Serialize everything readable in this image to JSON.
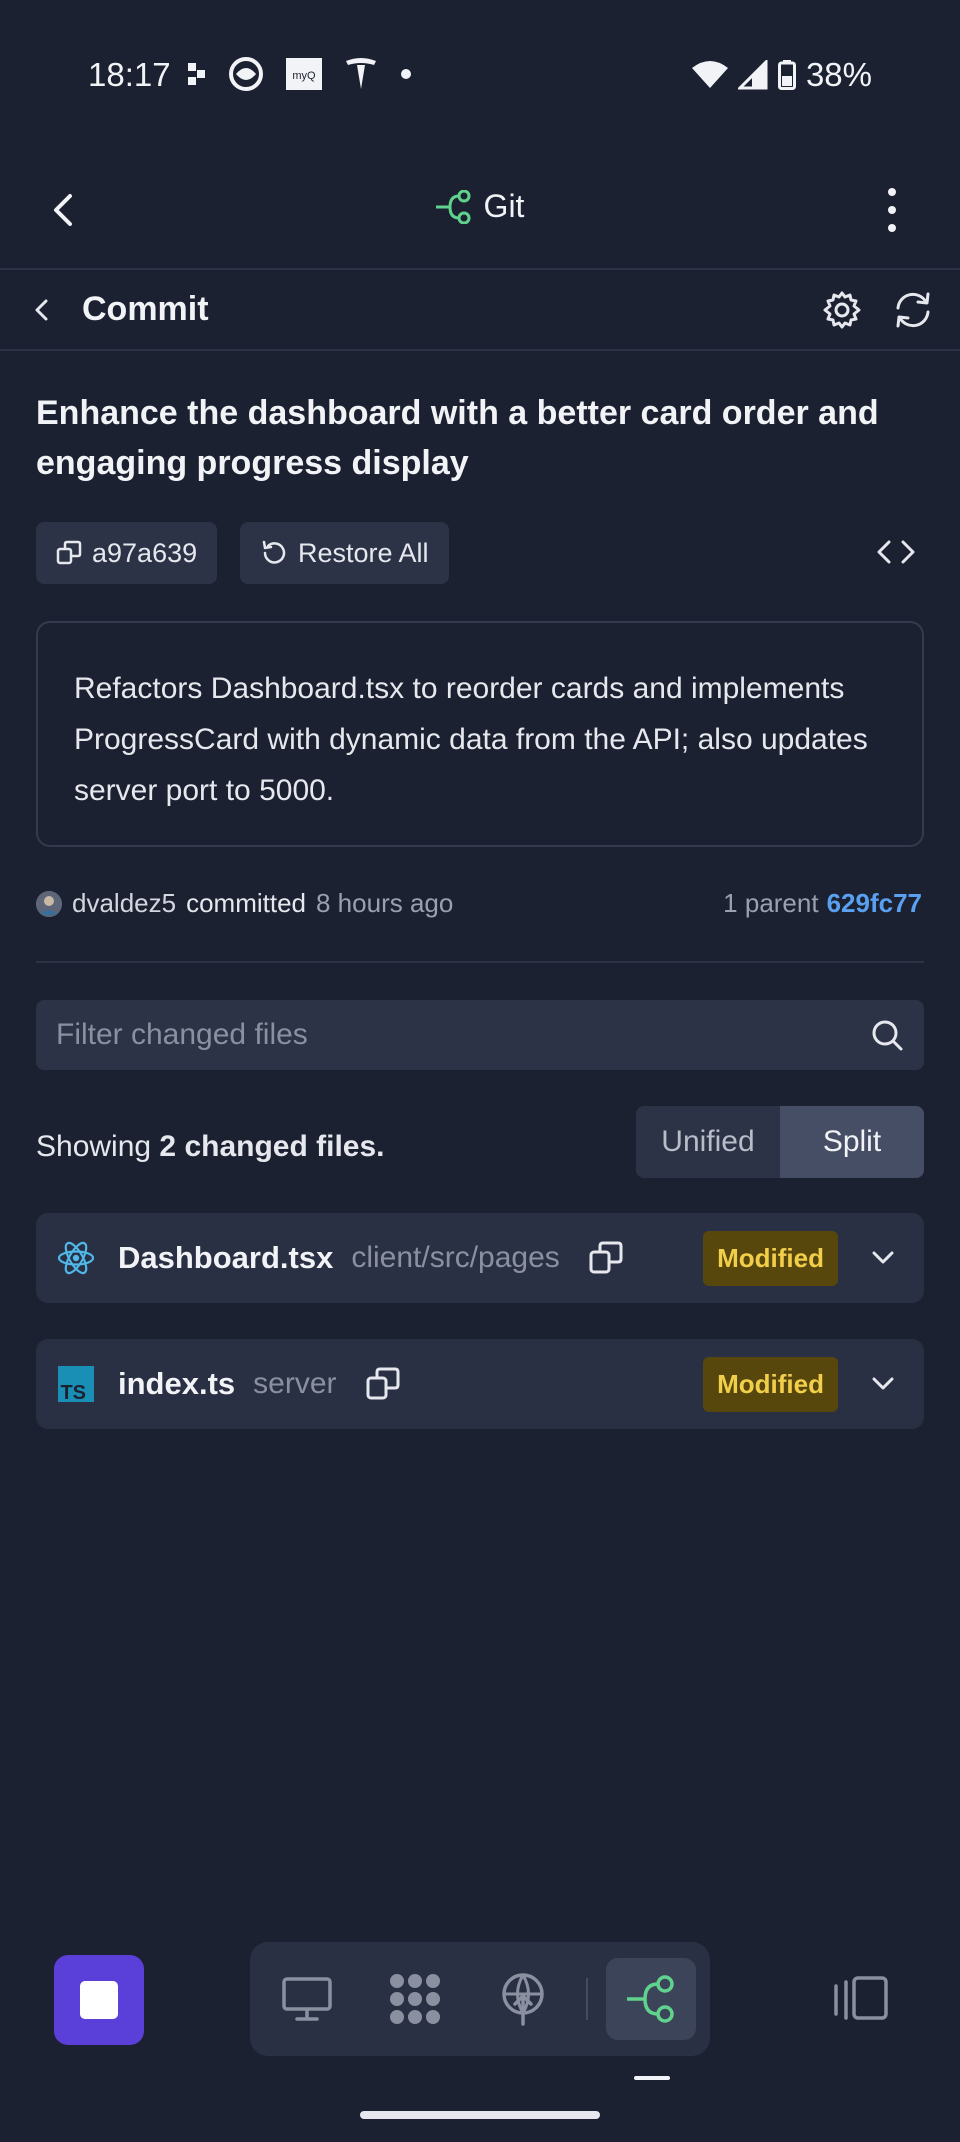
{
  "status_bar": {
    "time": "18:17",
    "battery": "38%",
    "left_icons": [
      "notification-dots-icon",
      "pinwheel-app-icon",
      "myq-app-icon",
      "tesla-app-icon",
      "dot-icon"
    ],
    "right_icons": [
      "wifi-icon",
      "cell-signal-icon",
      "battery-icon"
    ]
  },
  "app_bar": {
    "title": "Git"
  },
  "commit_header": {
    "title": "Commit"
  },
  "commit": {
    "heading": "Enhance the dashboard with a better card order and engaging progress display",
    "hash_label": "a97a639",
    "restore_label": "Restore All",
    "message": "Refactors Dashboard.tsx to reorder cards and implements ProgressCard with dynamic data from the API; also updates server port to 5000.",
    "author": "dvaldez5",
    "committed_label": "committed",
    "time_ago": "8 hours ago",
    "parent_label": "1 parent",
    "parent_hash": "629fc77"
  },
  "filter": {
    "placeholder": "Filter changed files"
  },
  "summary": {
    "prefix": "Showing",
    "count_text": "2 changed files."
  },
  "view_toggle": {
    "unified": "Unified",
    "split": "Split",
    "selected": "Split"
  },
  "files": [
    {
      "name": "Dashboard.tsx",
      "path": "client/src/pages",
      "status": "Modified",
      "icon": "react-icon"
    },
    {
      "name": "index.ts",
      "path": "server",
      "status": "Modified",
      "icon": "typescript-icon"
    }
  ],
  "colors": {
    "background": "#1c2131",
    "accent_green": "#5fd38d",
    "link_blue": "#5aa0f0",
    "badge_bg": "#57470c",
    "badge_text": "#f2cf4a",
    "fab_purple": "#5a3fd8"
  },
  "bottom_nav": {
    "items": [
      "desktop-icon",
      "apps-grid-icon",
      "network-icon",
      "git-icon"
    ],
    "active": "git-icon"
  }
}
